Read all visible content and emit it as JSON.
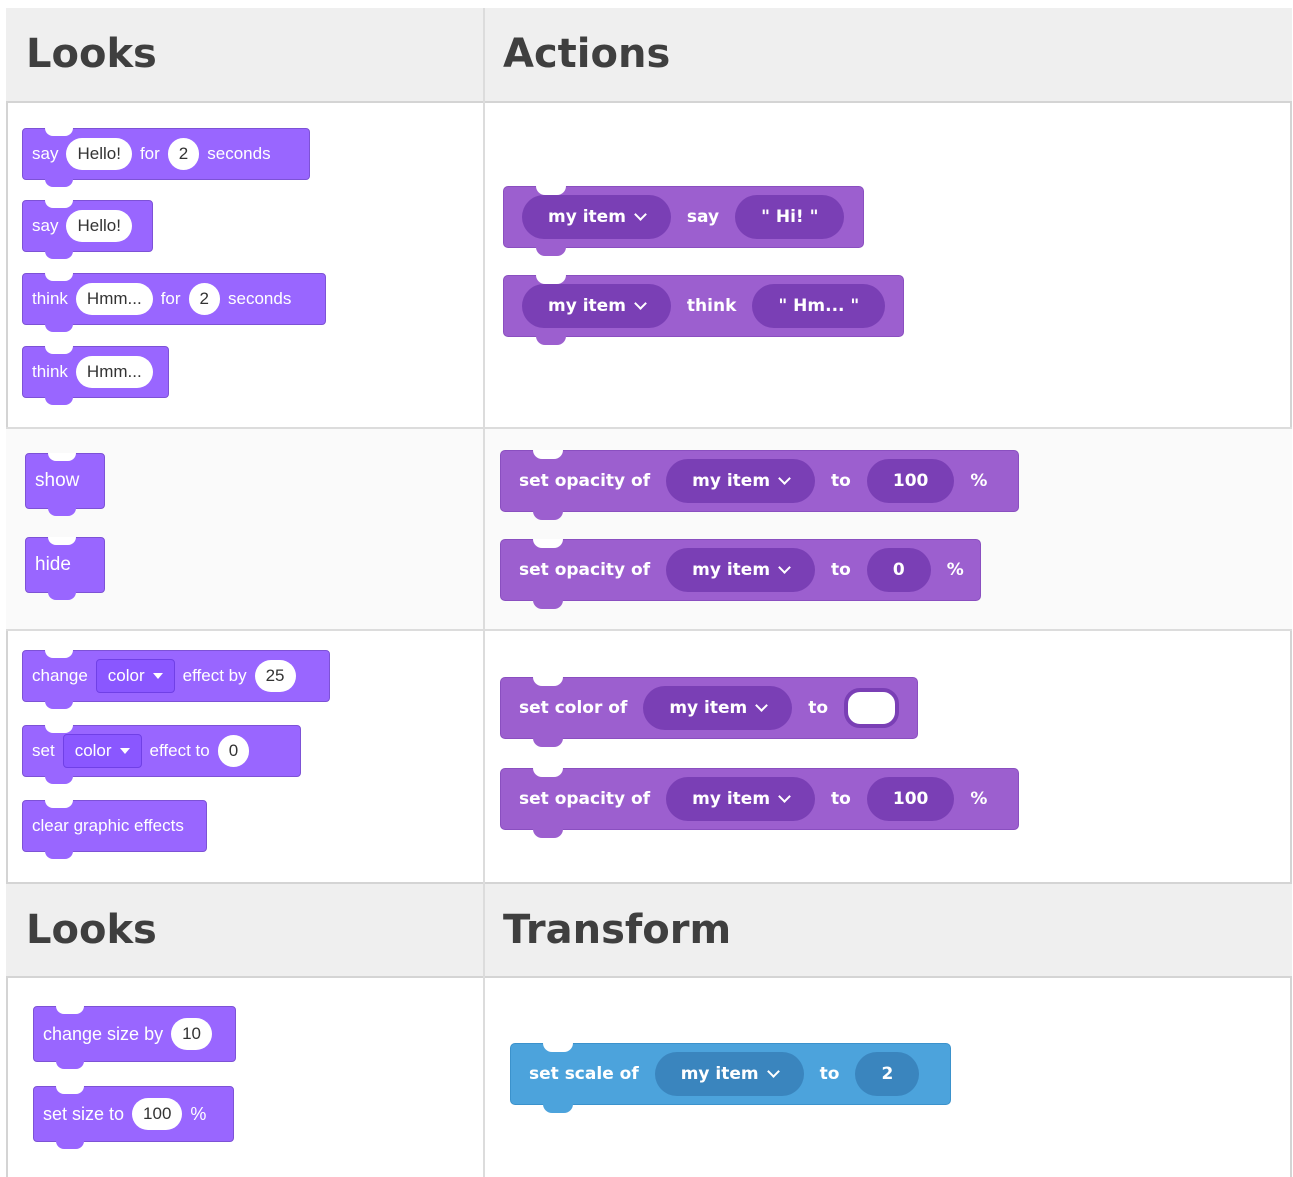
{
  "headers": {
    "section1_left": "Looks",
    "section1_right": "Actions",
    "section2_left": "Looks",
    "section2_right": "Transform"
  },
  "scratch": {
    "say_for": {
      "verb": "say",
      "text": "Hello!",
      "for": "for",
      "num": "2",
      "unit": "seconds"
    },
    "say": {
      "verb": "say",
      "text": "Hello!"
    },
    "think_for": {
      "verb": "think",
      "text": "Hmm...",
      "for": "for",
      "num": "2",
      "unit": "seconds"
    },
    "think": {
      "verb": "think",
      "text": "Hmm..."
    },
    "show": "show",
    "hide": "hide",
    "change_effect": {
      "verb": "change",
      "effect": "color",
      "by": "effect by",
      "num": "25"
    },
    "set_effect": {
      "verb": "set",
      "effect": "color",
      "to": "effect to",
      "num": "0"
    },
    "clear_effects": "clear graphic effects",
    "change_size": {
      "label": "change size by",
      "num": "10"
    },
    "set_size": {
      "label": "set size to",
      "num": "100",
      "unit": "%"
    }
  },
  "makecode": {
    "say": {
      "sprite": "my item",
      "verb": "say",
      "text": "\" Hi! \""
    },
    "think": {
      "sprite": "my item",
      "verb": "think",
      "text": "\" Hm... \""
    },
    "opacity_show": {
      "label": "set opacity of",
      "sprite": "my item",
      "to": "to",
      "num": "100",
      "unit": "%"
    },
    "opacity_hide": {
      "label": "set opacity of",
      "sprite": "my item",
      "to": "to",
      "num": "0",
      "unit": "%"
    },
    "set_color": {
      "label": "set color of",
      "sprite": "my item",
      "to": "to",
      "value_color": "#ffffff"
    },
    "opacity_reset": {
      "label": "set opacity of",
      "sprite": "my item",
      "to": "to",
      "num": "100",
      "unit": "%"
    },
    "scale": {
      "label": "set scale of",
      "sprite": "my item",
      "to": "to",
      "num": "2"
    }
  },
  "colors": {
    "looks_purple": "#9966ff",
    "actions_purple": "#9c5fcf",
    "transform_blue": "#4ca3dc",
    "header_bg": "#efefef"
  }
}
